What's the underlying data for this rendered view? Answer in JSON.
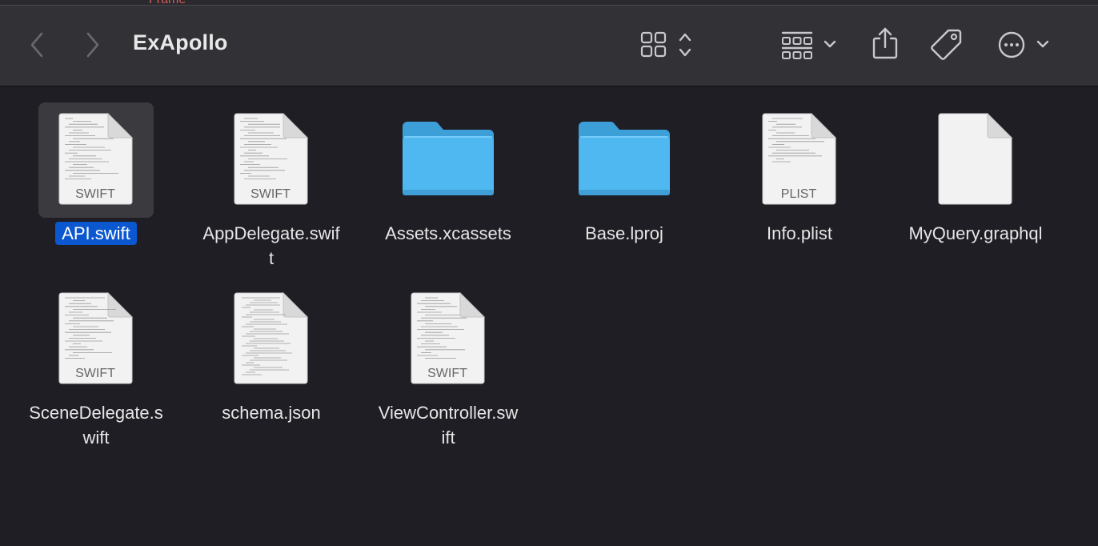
{
  "window": {
    "title": "ExApollo",
    "top_fragment": "Frame"
  },
  "toolbar": {
    "back_icon": "chevron-left-icon",
    "forward_icon": "chevron-right-icon",
    "view_icon": "icon-grid-view-icon",
    "group_icon": "group-by-icon",
    "share_icon": "share-icon",
    "tag_icon": "tag-icon",
    "more_icon": "ellipsis-circle-icon"
  },
  "files": [
    {
      "name": "API.swift",
      "line1": "API.swift",
      "line2": "",
      "kind": "swift",
      "badge": "SWIFT",
      "selected": true
    },
    {
      "name": "AppDelegate.swift",
      "line1": "AppDelegate.swif",
      "line2": "t",
      "kind": "swift",
      "badge": "SWIFT",
      "selected": false
    },
    {
      "name": "Assets.xcassets",
      "line1": "Assets.xcassets",
      "line2": "",
      "kind": "folder",
      "badge": "",
      "selected": false
    },
    {
      "name": "Base.lproj",
      "line1": "Base.lproj",
      "line2": "",
      "kind": "folder",
      "badge": "",
      "selected": false
    },
    {
      "name": "Info.plist",
      "line1": "Info.plist",
      "line2": "",
      "kind": "plist",
      "badge": "PLIST",
      "selected": false
    },
    {
      "name": "MyQuery.graphql",
      "line1": "MyQuery.graphql",
      "line2": "",
      "kind": "blank",
      "badge": "",
      "selected": false
    },
    {
      "name": "SceneDelegate.swift",
      "line1": "SceneDelegate.s",
      "line2": "wift",
      "kind": "swift",
      "badge": "SWIFT",
      "selected": false
    },
    {
      "name": "schema.json",
      "line1": "schema.json",
      "line2": "",
      "kind": "json",
      "badge": "",
      "selected": false
    },
    {
      "name": "ViewController.swift",
      "line1": "ViewController.sw",
      "line2": "ift",
      "kind": "swift",
      "badge": "SWIFT",
      "selected": false
    }
  ],
  "colors": {
    "folder": "#4fb8f0",
    "selection": "#0b57d0",
    "background": "#1f1e24",
    "toolbar": "#323236"
  }
}
